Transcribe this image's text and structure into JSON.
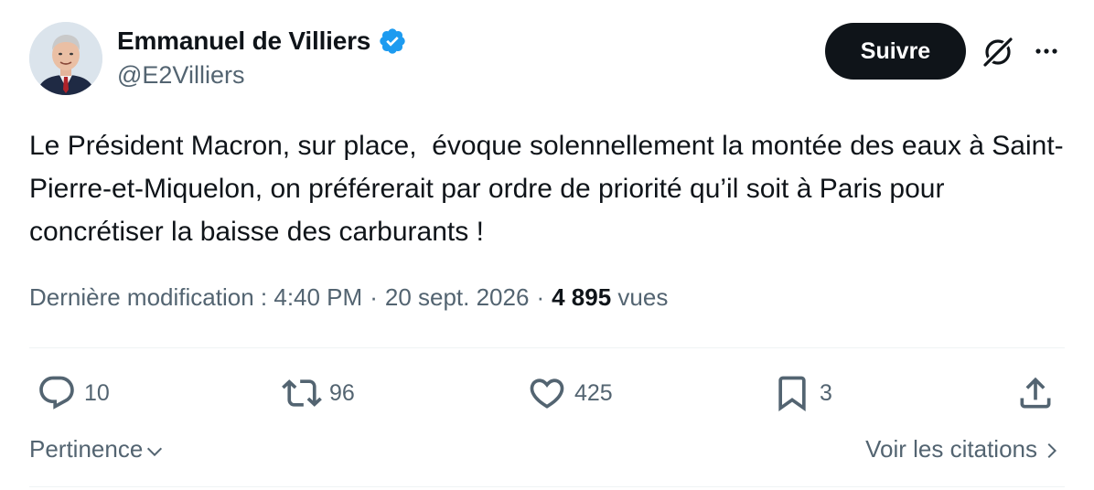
{
  "author": {
    "name": "Emmanuel de Villiers",
    "handle": "@E2Villiers",
    "avatar_icon": "profile-photo",
    "verified_icon": "verified-badge-icon",
    "verified_color": "#1d9bf0"
  },
  "header_actions": {
    "follow_label": "Suivre",
    "grok_icon": "grok-icon",
    "more_icon": "more-icon"
  },
  "tweet": {
    "text": "Le Président Macron, sur place,  évoque solennellement la montée des eaux à Saint-Pierre-et-Miquelon, on préférerait par ordre de priorité qu’il soit à Paris pour concrétiser la baisse des carburants !"
  },
  "meta": {
    "edited_label": "Dernière modification :",
    "time": "4:40 PM",
    "separator": "·",
    "date": "20 sept. 2026",
    "views_count": "4 895",
    "views_label": "vues"
  },
  "actions": {
    "replies": {
      "icon": "reply-icon",
      "count": "10"
    },
    "retweets": {
      "icon": "retweet-icon",
      "count": "96"
    },
    "likes": {
      "icon": "heart-icon",
      "count": "425"
    },
    "bookmarks": {
      "icon": "bookmark-icon",
      "count": "3"
    },
    "share": {
      "icon": "share-icon"
    }
  },
  "footer": {
    "sort_label": "Pertinence",
    "quotes_label": "Voir les citations"
  },
  "colors": {
    "text": "#0f1419",
    "secondary": "#536471",
    "accent": "#1d9bf0",
    "divider": "#eff3f4"
  }
}
